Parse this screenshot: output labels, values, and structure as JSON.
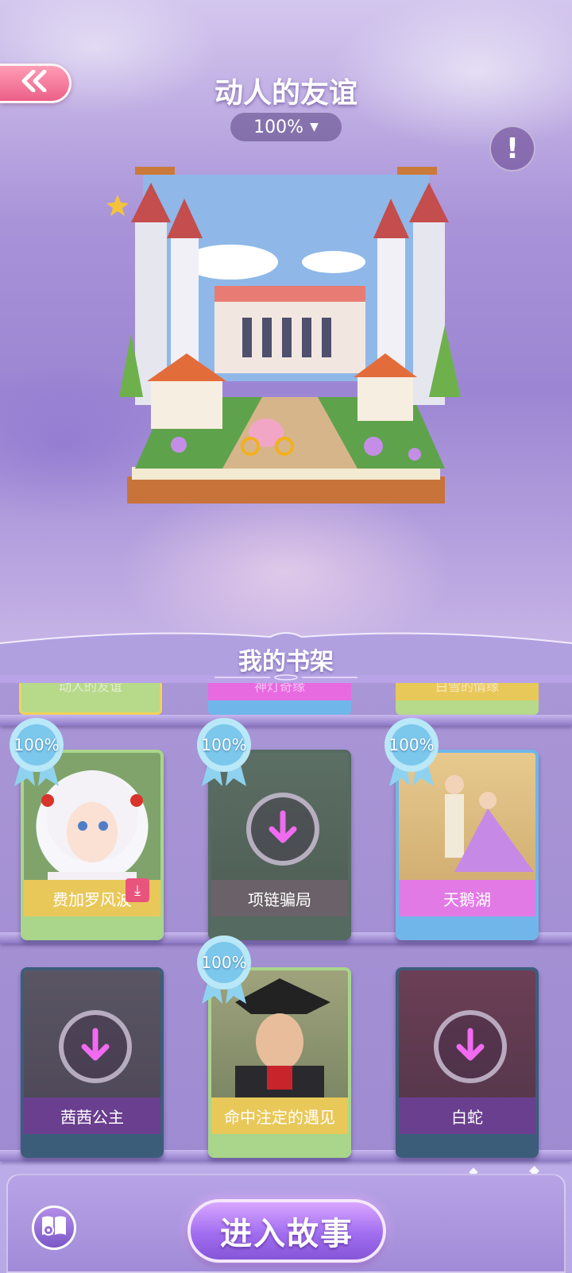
{
  "header": {
    "back_icon": "double-chevron-left-icon",
    "title": "动人的友谊",
    "progress": "100%",
    "info_icon": "exclamation-icon"
  },
  "shelf": {
    "title": "我的书架",
    "top_row": [
      {
        "title": "动人的友谊",
        "color": "#b7d98a"
      },
      {
        "title": "神灯奇缘",
        "color": "#e86ae0"
      },
      {
        "title": "白雪的情缘",
        "color": "#b7d98a"
      }
    ],
    "rows": [
      [
        {
          "title": "费加罗风波",
          "badge": "100%",
          "downloaded": true,
          "label_color": "#e9c85a",
          "frame": "#a9d68b"
        },
        {
          "title": "项链骗局",
          "badge": "100%",
          "downloaded": false,
          "label_color": "#6b6168",
          "frame": "#556a60"
        },
        {
          "title": "天鹅湖",
          "badge": "100%",
          "downloaded": true,
          "label_color": "#e27ae6",
          "frame": "#71b6ea"
        }
      ],
      [
        {
          "title": "茜茜公主",
          "badge": "",
          "downloaded": false,
          "label_color": "#6a3f8f",
          "frame": "#3c5d7a"
        },
        {
          "title": "命中注定的遇见",
          "badge": "100%",
          "downloaded": true,
          "label_color": "#e9c85a",
          "frame": "#a9d68b"
        },
        {
          "title": "白蛇",
          "badge": "",
          "downloaded": false,
          "label_color": "#6a3f8f",
          "frame": "#3c5d7a"
        }
      ]
    ]
  },
  "footer": {
    "settings_icon": "book-gear-icon",
    "enter_label": "进入故事"
  }
}
